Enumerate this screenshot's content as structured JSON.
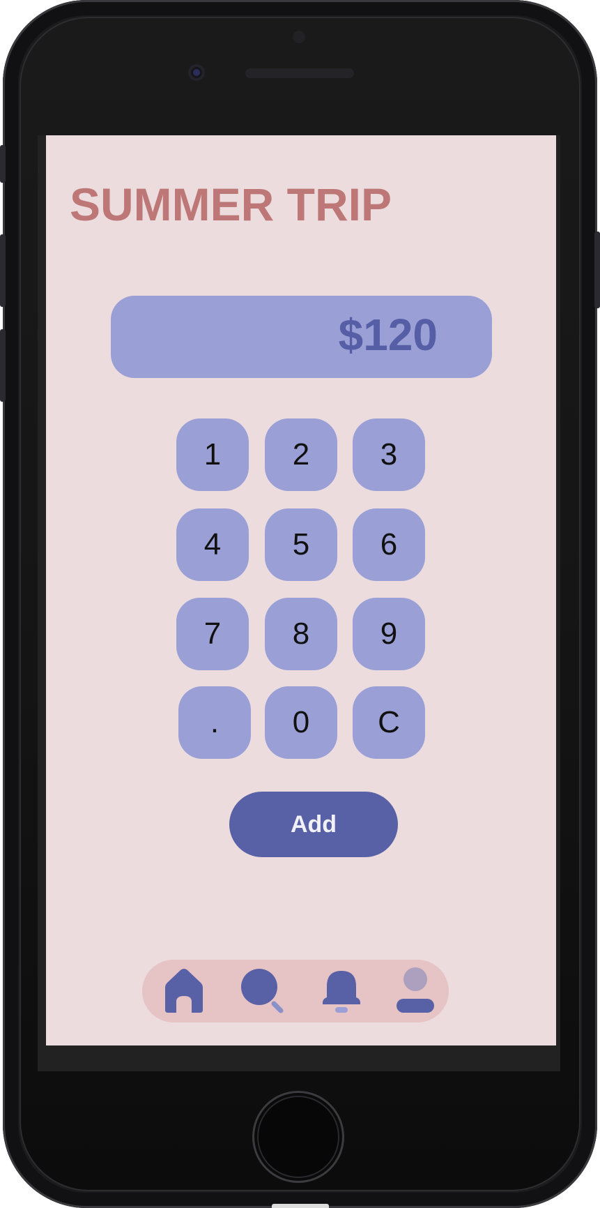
{
  "app": {
    "title": "SUMMER TRIP"
  },
  "amount": {
    "value": "$120"
  },
  "keypad": {
    "keys": [
      "1",
      "2",
      "3",
      "4",
      "5",
      "6",
      "7",
      "8",
      "9",
      ".",
      "0",
      "C"
    ]
  },
  "actions": {
    "add_label": "Add"
  },
  "nav": {
    "items": [
      {
        "icon": "home-icon",
        "active": true
      },
      {
        "icon": "search-icon",
        "active": false
      },
      {
        "icon": "bell-icon",
        "active": false
      },
      {
        "icon": "profile-icon",
        "active": false
      }
    ]
  },
  "colors": {
    "background": "#ecdcde",
    "title": "#bd7777",
    "accent_light": "#9aa0d6",
    "accent_dark": "#5860a6",
    "nav_background": "#e6c3c5"
  }
}
